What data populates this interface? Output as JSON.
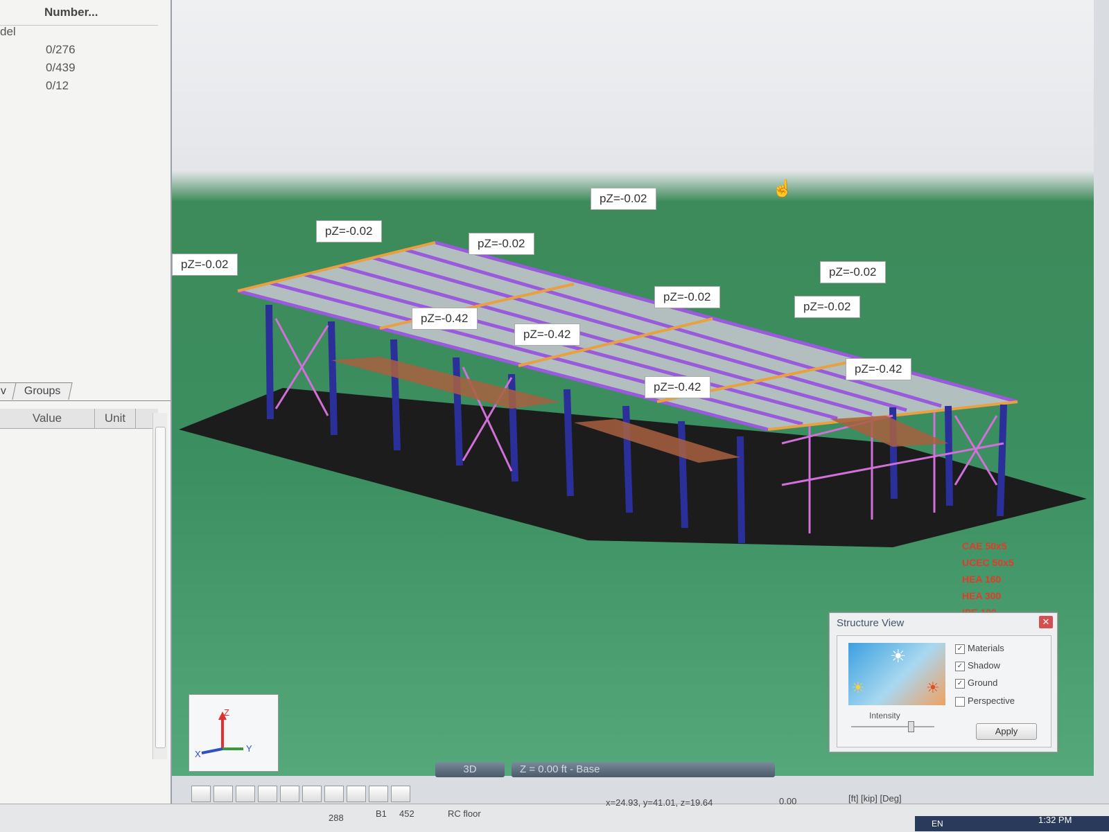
{
  "object_table": {
    "header_number": "Number...",
    "rows": [
      {
        "name": "del",
        "number": ""
      },
      {
        "name": "",
        "number": "0/276"
      },
      {
        "name": "",
        "number": "0/439"
      },
      {
        "name": "",
        "number": "0/12"
      }
    ]
  },
  "tabs": {
    "first": "v",
    "groups": "Groups"
  },
  "properties": {
    "col_value": "Value",
    "col_unit": "Unit"
  },
  "loads": [
    {
      "text": "pZ=-0.02",
      "pos": "left"
    },
    {
      "text": "pZ=-0.02",
      "pos": "a"
    },
    {
      "text": "pZ=-0.02",
      "pos": "b"
    },
    {
      "text": "pZ=-0.02",
      "pos": "c"
    },
    {
      "text": "pZ=-0.02",
      "pos": "d"
    },
    {
      "text": "pZ=-0.02",
      "pos": "e"
    },
    {
      "text": "pZ=-0.02",
      "pos": "f"
    },
    {
      "text": "pZ=-0.42",
      "pos": "g"
    },
    {
      "text": "pZ=-0.42",
      "pos": "h"
    },
    {
      "text": "pZ=-0.42",
      "pos": "i"
    },
    {
      "text": "pZ=-0.42",
      "pos": "j"
    }
  ],
  "section_legend": [
    "CAE 50x5",
    "UCEC 50x5",
    "HEA 160",
    "HEA 300",
    "IPE 100"
  ],
  "structure_view": {
    "title": "Structure View",
    "options": [
      {
        "label": "Materials",
        "checked": true
      },
      {
        "label": "Shadow",
        "checked": true
      },
      {
        "label": "Ground",
        "checked": true
      },
      {
        "label": "Perspective",
        "checked": false
      }
    ],
    "intensity_label": "Intensity",
    "intensity_level": 0.72,
    "apply": "Apply"
  },
  "view_mode": "3D",
  "level": "Z = 0.00 ft - Base",
  "axes": {
    "z": "Z",
    "y": "Y",
    "x": "X"
  },
  "status": {
    "nodes": "288",
    "bars_prefix": "B1",
    "bars": "452",
    "floor": "RC floor",
    "coords": "x=24.93, y=41.01, z=19.64",
    "angle": "0.00",
    "units": "[ft] [kip] [Deg]",
    "lang": "EN",
    "time": "1:32 PM"
  },
  "colors": {
    "columns": "#2b2f9a",
    "bracing": "#d070d8",
    "purlins": "#9a5adc",
    "rafters": "#e8a040",
    "ground": "#3b8f60",
    "shadow": "#1c1c1c",
    "roof": "#c8c8d0"
  }
}
